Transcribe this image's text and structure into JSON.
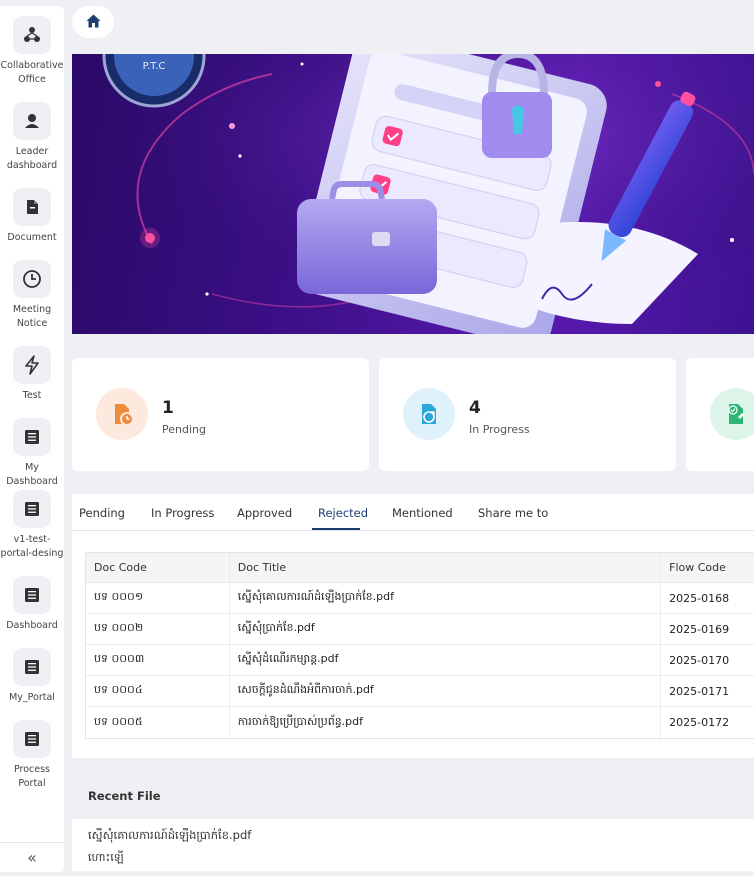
{
  "sidebar": {
    "items": [
      {
        "label": "Collaborative Office",
        "icon": "collaboration-icon"
      },
      {
        "label": "Leader dashboard",
        "icon": "user-icon"
      },
      {
        "label": "Document",
        "icon": "document-icon"
      },
      {
        "label": "Meeting Notice",
        "icon": "clock-icon"
      },
      {
        "label": "Test",
        "icon": "lightning-icon"
      },
      {
        "label": "My Dashboard",
        "icon": "list-icon"
      },
      {
        "label": "v1-test-portal-desing",
        "icon": "list-icon"
      },
      {
        "label": "Dashboard",
        "icon": "list-icon"
      },
      {
        "label": "My_Portal",
        "icon": "list-icon"
      },
      {
        "label": "Process Portal",
        "icon": "list-icon"
      }
    ],
    "collapse_label": "«"
  },
  "banner": {
    "logo_text": "P.T.C"
  },
  "stats": [
    {
      "value": "1",
      "label": "Pending",
      "color": "#f08a3c"
    },
    {
      "value": "4",
      "label": "In Progress",
      "color": "#2aa6d8"
    },
    {
      "color": "#2bb673"
    }
  ],
  "tabs": {
    "items": [
      "Pending",
      "In Progress",
      "Approved",
      "Rejected",
      "Mentioned",
      "Share me to"
    ],
    "active": "Rejected"
  },
  "table": {
    "headers": [
      "Doc Code",
      "Doc Title",
      "Flow Code"
    ],
    "rows": [
      [
        "បទ ០០០១",
        "ស្នើសុំគោលការណ៍ដំឡើងប្រាក់ខែ.pdf",
        "2025-0168"
      ],
      [
        "បទ ០០០២",
        "ស្នើសុំប្រាក់ខែ.pdf",
        "2025-0169"
      ],
      [
        "បទ ០០០៣",
        "ស្នើសុំដំណើរកម្សាន្ត.pdf",
        "2025-0170"
      ],
      [
        "បទ ០០០៤",
        "សេចក្តីជូនដំណឹងអំពីការចាក់.pdf",
        "2025-0171"
      ],
      [
        "បទ ០០០៥",
        "ការចាក់ឱ្យប្រើប្រាស់ប្រព័ន្ធ.pdf",
        "2025-0172"
      ]
    ]
  },
  "recent": {
    "title": "Recent File",
    "file_name": "ស្នើសុំគោលការណ៍ដំឡើងប្រាក់ខែ.pdf",
    "subtitle": "ហោះឡើ"
  },
  "colors": {
    "accent": "#1c3f70",
    "background": "#eef0f4"
  }
}
